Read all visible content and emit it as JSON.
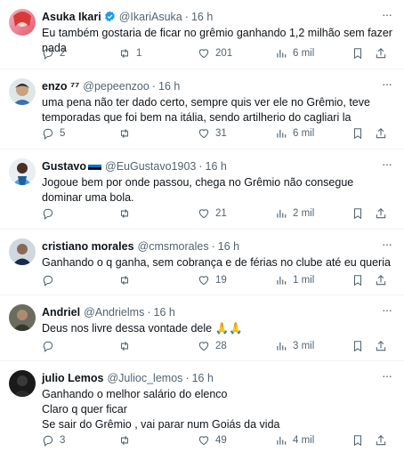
{
  "tweets": [
    {
      "name": "Asuka Ikari",
      "handle": "@IkariAsuka",
      "time": "16 h",
      "text": "Eu também gostaria de ficar no grêmio ganhando 1,2 milhão sem fazer nada",
      "replies": "2",
      "retweets": "1",
      "likes": "201",
      "views": "6 mil",
      "verified": true
    },
    {
      "name": "enzo ⁷⁷",
      "handle": "@pepeenzoo",
      "time": "16 h",
      "text": "uma pena não ter dado certo, sempre quis ver ele no Grêmio, teve temporadas que foi bem na itália, sendo artilherio do cagliari la",
      "replies": "5",
      "retweets": "",
      "likes": "31",
      "views": "6 mil"
    },
    {
      "name": "Gustavo",
      "handle": "@EuGustavo1903",
      "time": "16 h",
      "text": "Jogoue bem por onde passou, chega no Grêmio não consegue dominar uma bola.",
      "replies": "",
      "retweets": "",
      "likes": "21",
      "views": "2 mil"
    },
    {
      "name": "cristiano morales",
      "handle": "@cmsmorales",
      "time": "16 h",
      "text": "Ganhando o q ganha, sem cobrança e de férias no clube até eu queria",
      "replies": "",
      "retweets": "",
      "likes": "19",
      "views": "1 mil"
    },
    {
      "name": "Andriel",
      "handle": "@Andrielms",
      "time": "16 h",
      "text": "Deus nos livre dessa vontade dele 🙏🙏",
      "replies": "",
      "retweets": "",
      "likes": "28",
      "views": "3 mil"
    },
    {
      "name": "julio Lemos",
      "handle": "@Julioc_lemos",
      "time": "16 h",
      "text": "Ganhando o melhor salário do elenco\nClaro q quer ficar\nSe sair do Grêmio , vai parar num Goiás da vida",
      "replies": "3",
      "retweets": "",
      "likes": "49",
      "views": "4 mil"
    }
  ],
  "more_glyph": "···",
  "colors": {
    "verified": "#1d9bf0",
    "muted": "#536471",
    "divider": "#eff3f4"
  }
}
